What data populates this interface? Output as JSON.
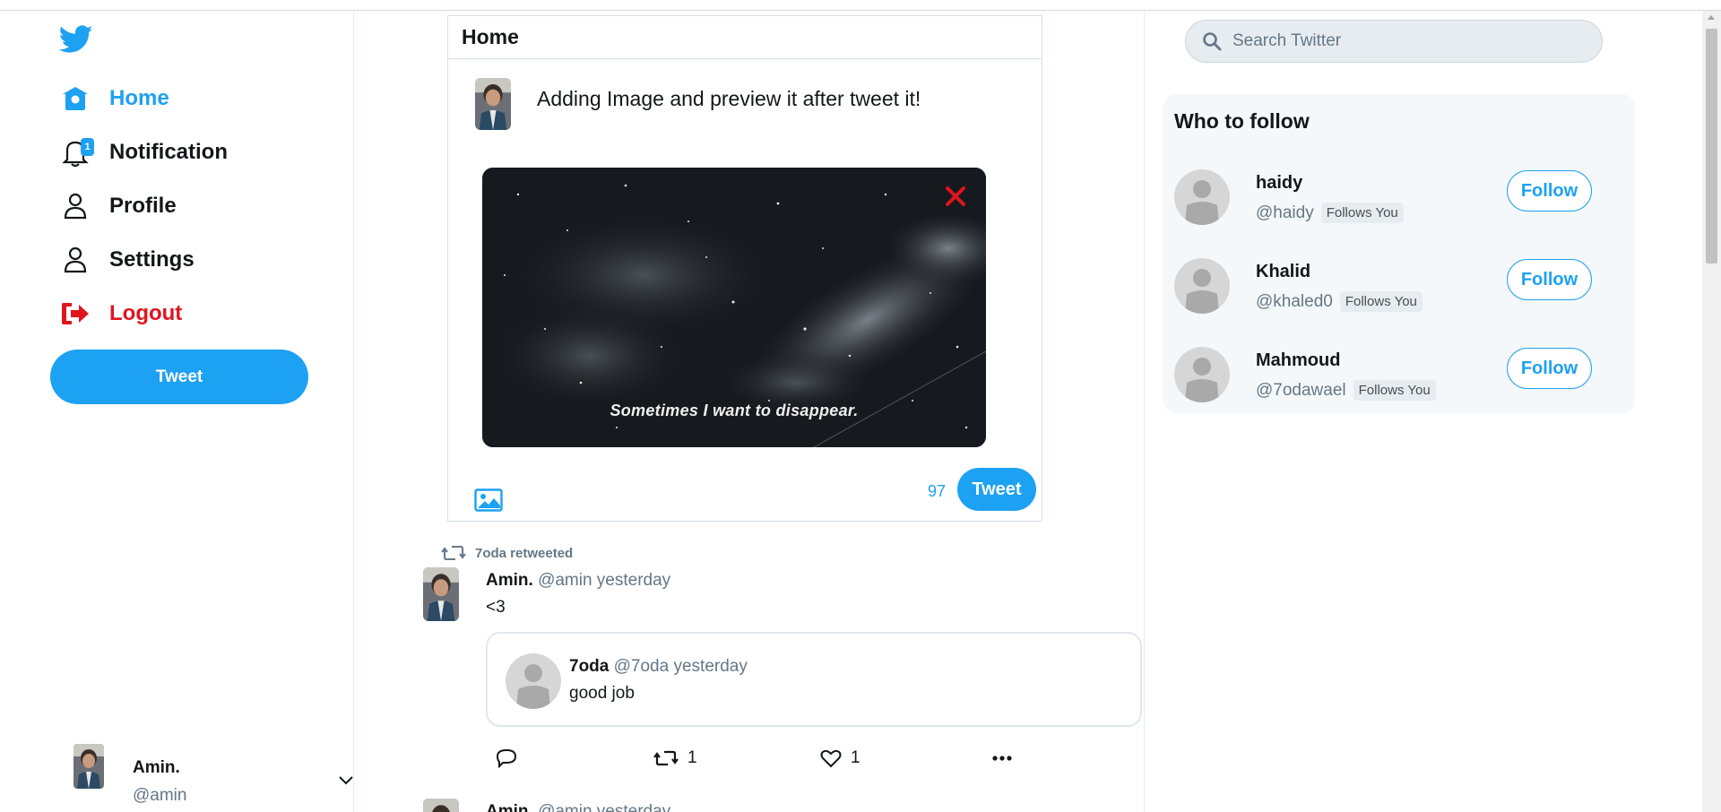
{
  "sidebar": {
    "nav": [
      {
        "label": "Home",
        "icon": "home-icon"
      },
      {
        "label": "Notification",
        "icon": "bell-icon",
        "badge": "1"
      },
      {
        "label": "Profile",
        "icon": "user-icon"
      },
      {
        "label": "Settings",
        "icon": "user-icon"
      },
      {
        "label": "Logout",
        "icon": "sign-out-icon"
      }
    ],
    "tweet_button": "Tweet",
    "account": {
      "name": "Amin.",
      "handle": "@amin"
    }
  },
  "compose": {
    "header": "Home",
    "text": "Adding Image and preview it after tweet it!",
    "image_caption": "Sometimes I want to disappear.",
    "char_count": "97",
    "submit_label": "Tweet"
  },
  "feed": {
    "retweet_label": "7oda retweeted",
    "post": {
      "name": "Amin.",
      "meta": "@amin yesterday",
      "body": "<3",
      "quote": {
        "name": "7oda",
        "meta": "@7oda yesterday",
        "body": "good job"
      },
      "retweets": "1",
      "likes": "1"
    },
    "next_post": {
      "name": "Amin.",
      "meta": "@amin yesterday"
    }
  },
  "search": {
    "placeholder": "Search Twitter"
  },
  "who_to_follow": {
    "title": "Who to follow",
    "users": [
      {
        "name": "haidy",
        "handle": "@haidy",
        "badge": "Follows You",
        "button": "Follow"
      },
      {
        "name": "Khalid",
        "handle": "@khaled0",
        "badge": "Follows You",
        "button": "Follow"
      },
      {
        "name": "Mahmoud",
        "handle": "@7odawael",
        "badge": "Follows You",
        "button": "Follow"
      }
    ]
  },
  "colors": {
    "accent": "#1da1f2",
    "logout": "#e0141e",
    "muted": "#657786"
  }
}
